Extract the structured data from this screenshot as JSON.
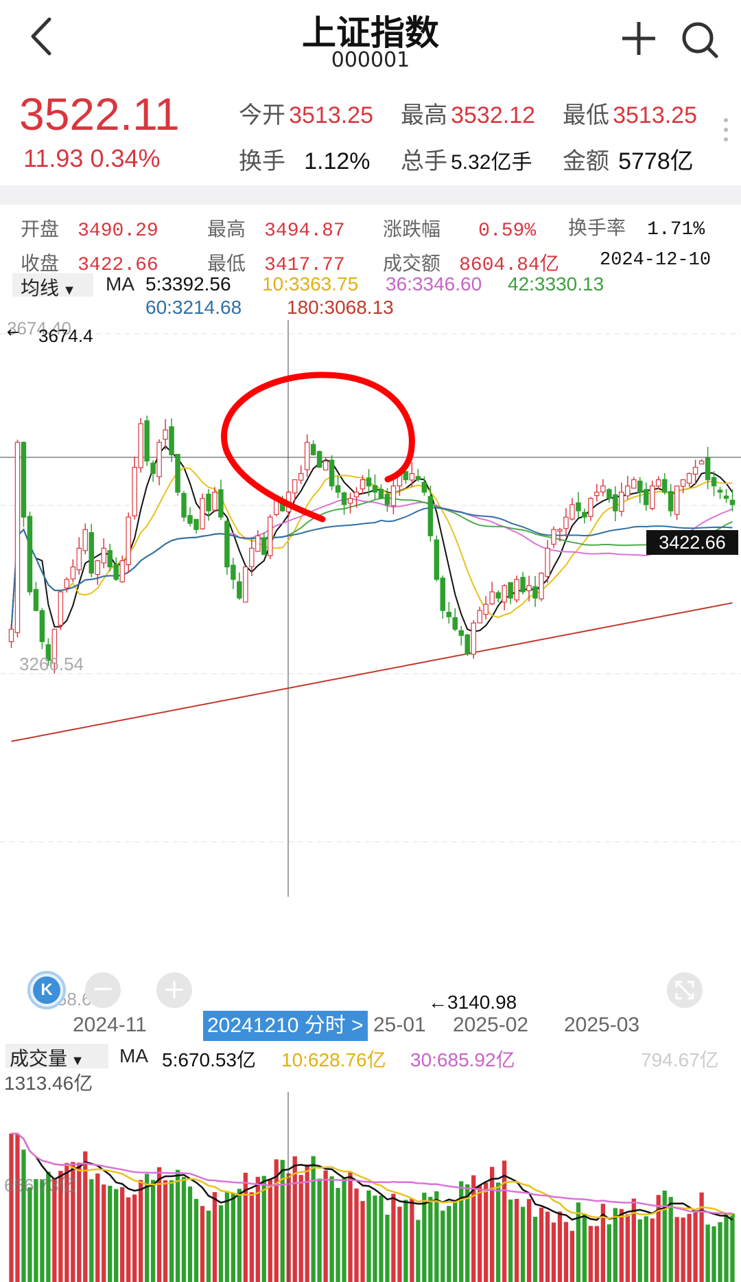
{
  "header": {
    "title": "上证指数",
    "code": "000001"
  },
  "quote": {
    "price": "3522.11",
    "change": "11.93",
    "change_pct": "0.34%",
    "open_label": "今开",
    "open": "3513.25",
    "high_label": "最高",
    "high": "3532.12",
    "low_label": "最低",
    "low": "3513.25",
    "turnover_label": "换手",
    "turnover": "1.12%",
    "volume_label": "总手",
    "volume": "5.32亿手",
    "amount_label": "金额",
    "amount": "5778亿"
  },
  "day_info": {
    "open_label": "开盘",
    "open": "3490.29",
    "high_label": "最高",
    "high": "3494.87",
    "pct_label": "涨跌幅",
    "pct": "0.59%",
    "turnover_label": "换手率",
    "turnover": "1.71%",
    "close_label": "收盘",
    "close": "3422.66",
    "low_label": "最低",
    "low": "3417.77",
    "amount_label": "成交额",
    "amount": "8604.84亿",
    "date": "2024-12-10"
  },
  "ma_legend": {
    "selector": "均线",
    "ma": "MA",
    "ma5": "5:3392.56",
    "ma10": "10:3363.75",
    "ma36": "36:3346.60",
    "ma42": "42:3330.13",
    "ma60": "60:3214.68",
    "ma180": "180:3068.13"
  },
  "price_chart": {
    "top_ghost": "3674.40",
    "top": "3674.4",
    "mid_ghost": "3266.54",
    "bottom_ghost": "2858.67",
    "low_marker": "3140.98",
    "cursor_price": "3422.66",
    "x_ticks": [
      "2024-11",
      "25-01",
      "2025-02",
      "2025-03"
    ],
    "cursor_date_tag": "20241210 分时 >",
    "k_badge": "K"
  },
  "volume_legend": {
    "selector": "成交量",
    "ma": "MA",
    "ma5": "5:670.53亿",
    "ma10": "10:628.76亿",
    "ma30": "30:685.92亿",
    "right_value": "794.67亿",
    "top": "1313.46亿",
    "mid": "656.73亿"
  },
  "colors": {
    "up": "#d9363e",
    "down": "#2ea02e",
    "ma5": "#111111",
    "ma10": "#e8c21a",
    "ma36": "#d973d9",
    "ma42": "#4caa4c",
    "ma60": "#2f6fa5",
    "ma180": "#c0392b",
    "annotation": "#ff0000"
  },
  "chart_data": {
    "type": "candlestick",
    "symbol": "上证指数",
    "x_ticks": [
      "2024-11",
      "25-01",
      "2025-02",
      "2025-03"
    ],
    "ylim": [
      2858.67,
      3674.4
    ],
    "closes": [
      3200,
      3500,
      3380,
      3260,
      3230,
      3180,
      3150,
      3200,
      3260,
      3280,
      3300,
      3330,
      3360,
      3290,
      3310,
      3330,
      3300,
      3280,
      3310,
      3380,
      3460,
      3530,
      3470,
      3450,
      3500,
      3520,
      3480,
      3420,
      3380,
      3370,
      3360,
      3410,
      3390,
      3420,
      3380,
      3300,
      3280,
      3250,
      3300,
      3330,
      3350,
      3320,
      3380,
      3410,
      3390,
      3420,
      3440,
      3450,
      3500,
      3480,
      3460,
      3470,
      3430,
      3420,
      3400,
      3410,
      3420,
      3440,
      3430,
      3420,
      3410,
      3400,
      3430,
      3450,
      3440,
      3450,
      3440,
      3420,
      3350,
      3280,
      3230,
      3220,
      3200,
      3190,
      3160,
      3210,
      3230,
      3240,
      3260,
      3250,
      3270,
      3250,
      3280,
      3260,
      3270,
      3250,
      3290,
      3330,
      3360,
      3360,
      3380,
      3400,
      3390,
      3380,
      3410,
      3420,
      3430,
      3410,
      3390,
      3420,
      3430,
      3440,
      3420,
      3400,
      3430,
      3440,
      3420,
      3390,
      3430,
      3440,
      3450,
      3460,
      3470,
      3440,
      3430,
      3420,
      3410,
      3400
    ]
  }
}
